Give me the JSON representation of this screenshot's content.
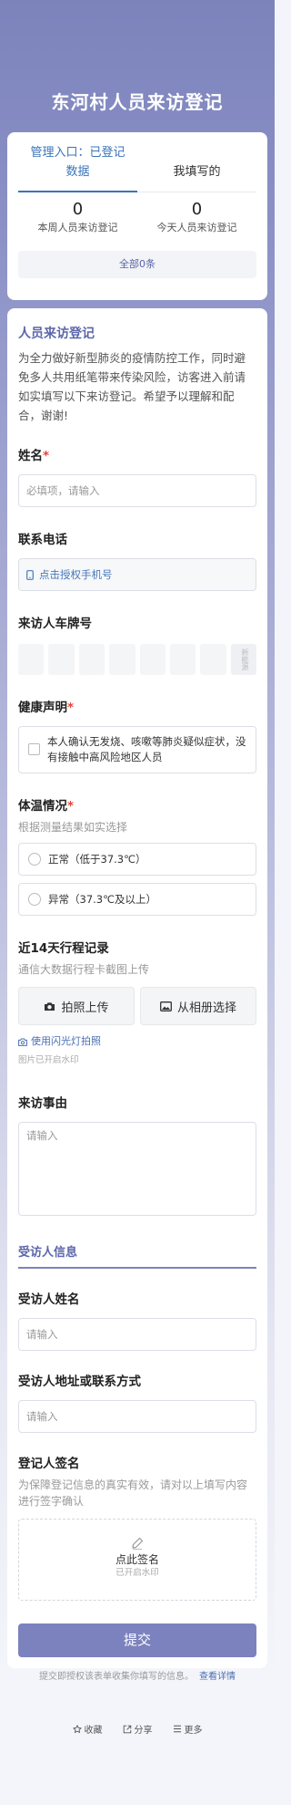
{
  "header": {
    "title": "东河村人员来访登记"
  },
  "stats": {
    "tab_admin_line1": "管理入口：已登记",
    "tab_admin_line2": "数据",
    "tab_mine": "我填写的",
    "week_count": "0",
    "week_label": "本周人员来访登记",
    "today_count": "0",
    "today_label": "今天人员来访登记",
    "all_button": "全部0条"
  },
  "form": {
    "title": "人员来访登记",
    "intro": "为全力做好新型肺炎的疫情防控工作，同时避免多人共用纸笔带来传染风险，访客进入前请如实填写以下来访登记。希望予以理解和配合，谢谢!",
    "name": {
      "label": "姓名",
      "required_mark": "*",
      "placeholder": "必填项，请输入"
    },
    "phone": {
      "label": "联系电话",
      "button": "点击授权手机号"
    },
    "plate": {
      "label": "来访人车牌号",
      "new_energy": "新能源"
    },
    "health": {
      "label": "健康声明",
      "required_mark": "*",
      "statement": "本人确认无发烧、咳嗽等肺炎疑似症状，没有接触中高风险地区人员"
    },
    "temperature": {
      "label": "体温情况",
      "required_mark": "*",
      "hint": "根据测量结果如实选择",
      "options": [
        "正常（低于37.3℃）",
        "异常（37.3℃及以上）"
      ]
    },
    "travel": {
      "label": "近14天行程记录",
      "hint": "通信大数据行程卡截图上传",
      "camera_button": "拍照上传",
      "album_button": "从相册选择",
      "flash_link": "使用闪光灯拍照",
      "watermark_note": "图片已开启水印"
    },
    "reason": {
      "label": "来访事由",
      "placeholder": "请输入"
    },
    "visitee_section": "受访人信息",
    "visitee_name": {
      "label": "受访人姓名",
      "placeholder": "请输入"
    },
    "visitee_contact": {
      "label": "受访人地址或联系方式",
      "placeholder": "请输入"
    },
    "signature": {
      "label": "登记人签名",
      "hint": "为保障登记信息的真实有效，请对以上填写内容进行签字确认",
      "tap_text": "点此签名",
      "watermark_note": "已开启水印"
    },
    "submit": "提交",
    "agreement_text": "提交即授权该表单收集你填写的信息。",
    "agreement_link": "查看详情"
  },
  "footer": {
    "favorite": "收藏",
    "share": "分享",
    "more": "更多"
  },
  "colors": {
    "accent": "#7b82bd",
    "link": "#4a6fb0",
    "required": "#e0443a"
  }
}
